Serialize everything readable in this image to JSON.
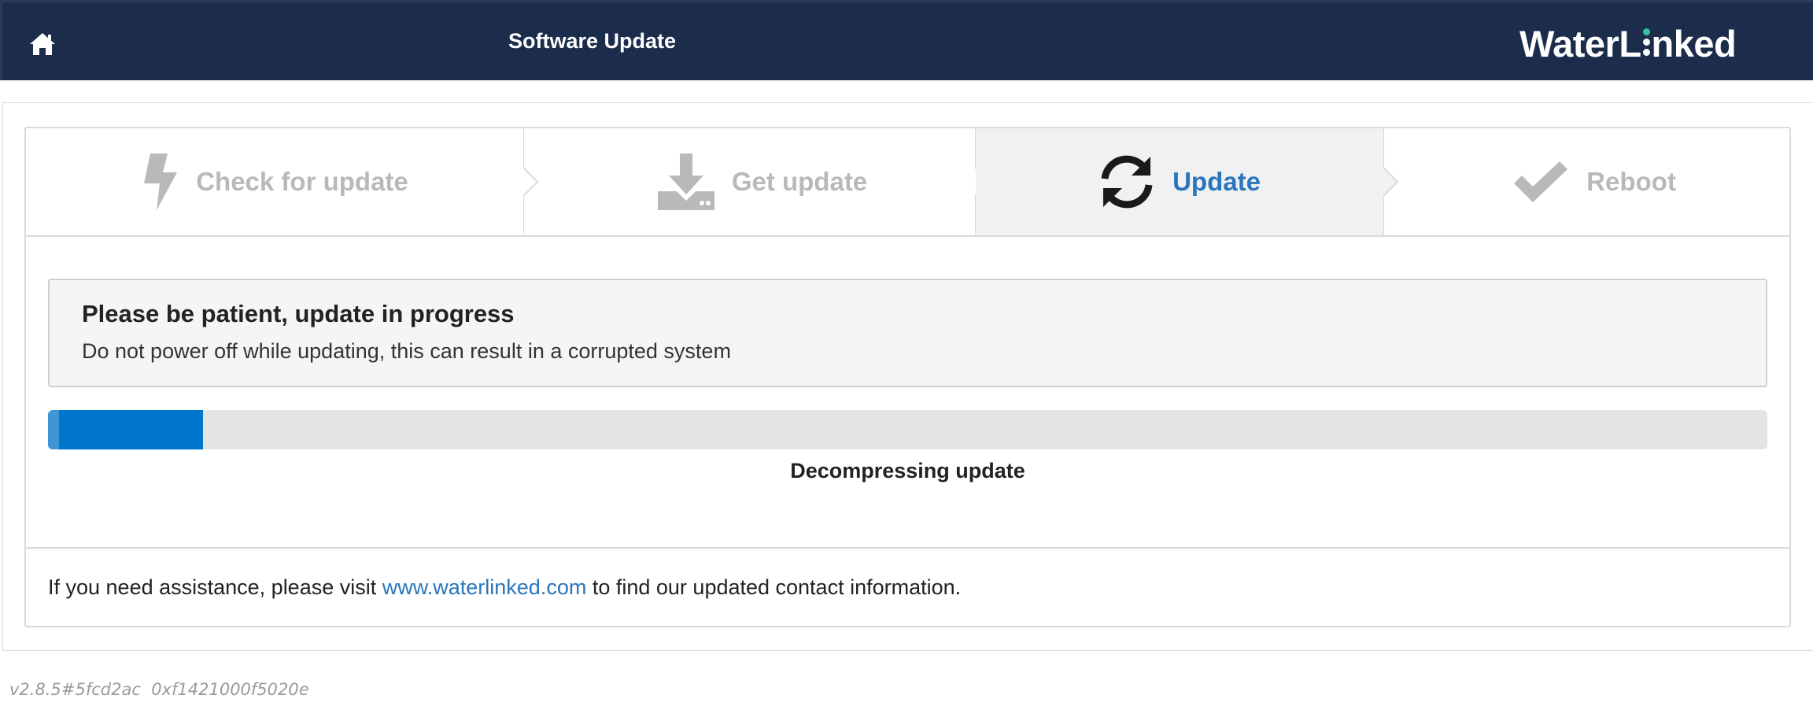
{
  "header": {
    "title": "Software Update",
    "home_icon": "home-icon",
    "logo": {
      "text_before": "WaterL",
      "text_after": "nked",
      "accent_color": "#34c5a0"
    },
    "background_color": "#1b2d4b"
  },
  "steps": [
    {
      "label": "Check for update",
      "icon": "lightning-icon",
      "state": "inactive"
    },
    {
      "label": "Get update",
      "icon": "download-icon",
      "state": "inactive"
    },
    {
      "label": "Update",
      "icon": "refresh-icon",
      "state": "active"
    },
    {
      "label": "Reboot",
      "icon": "check-icon",
      "state": "inactive"
    }
  ],
  "alert": {
    "title": "Please be patient, update in progress",
    "text": "Do not power off while updating, this can result in a corrupted system"
  },
  "progress": {
    "fraction": 0.09,
    "status": "Decompressing update",
    "color": "#0077cc"
  },
  "assistance": {
    "before": "If you need assistance, please visit ",
    "link": "www.waterlinked.com",
    "after": " to find our updated contact information."
  },
  "version": "v2.8.5#5fcd2ac  0xf1421000f5020e"
}
